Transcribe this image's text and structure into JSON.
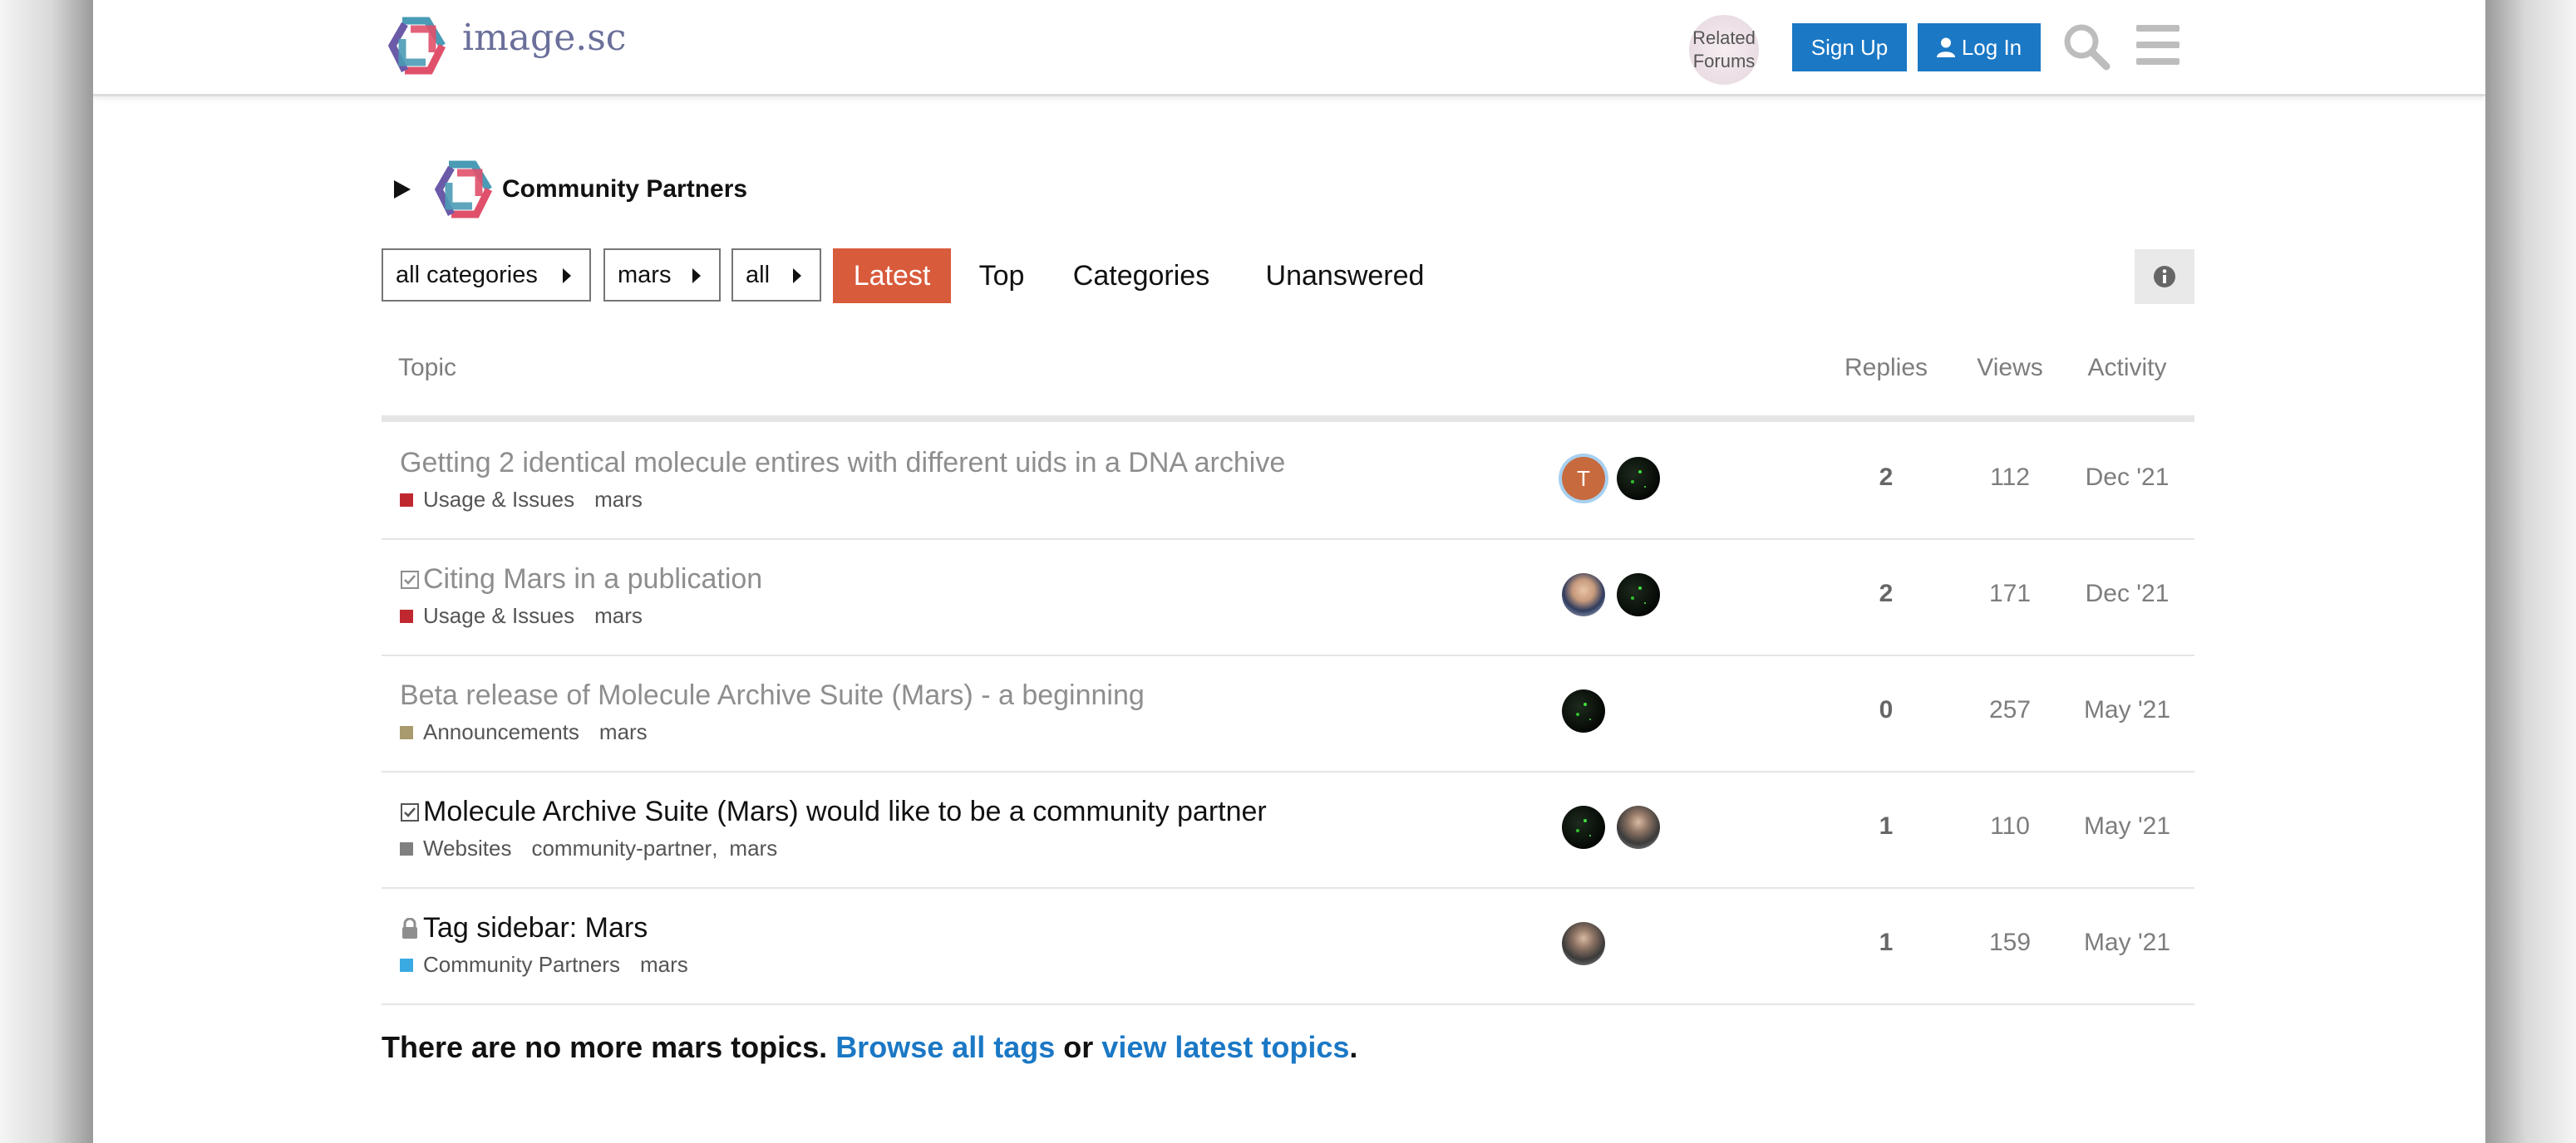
{
  "header": {
    "site_name": "image.sc",
    "related_line1": "Related",
    "related_line2": "Forums",
    "signup_label": "Sign Up",
    "login_label": "Log In",
    "icons": [
      "logo",
      "user-icon",
      "search-icon",
      "hamburger-menu-icon"
    ]
  },
  "category": {
    "title": "Community Partners"
  },
  "filters": {
    "categories": "all categories",
    "tag": "mars",
    "subset": "all"
  },
  "nav": {
    "items": [
      "Latest",
      "Top",
      "Categories",
      "Unanswered"
    ],
    "active": "Latest",
    "active_color": "#d85b3c"
  },
  "table": {
    "columns": [
      "Topic",
      "Replies",
      "Views",
      "Activity"
    ],
    "rows": [
      {
        "title": "Getting 2 identical molecule entires with different uids in a DNA archive",
        "status": "",
        "read": true,
        "category": "Usage & Issues",
        "category_color": "#c0282f",
        "tags": [
          "mars"
        ],
        "avatar_letter": "T",
        "replies": "2",
        "views": "112",
        "activity": "Dec '21"
      },
      {
        "title": "Citing Mars in a publication",
        "status": "solved",
        "read": true,
        "category": "Usage & Issues",
        "category_color": "#c0282f",
        "tags": [
          "mars"
        ],
        "replies": "2",
        "views": "171",
        "activity": "Dec '21"
      },
      {
        "title": "Beta release of Molecule Archive Suite (Mars) - a beginning",
        "status": "",
        "read": true,
        "category": "Announcements",
        "category_color": "#a89a6c",
        "tags": [
          "mars"
        ],
        "replies": "0",
        "views": "257",
        "activity": "May '21"
      },
      {
        "title": "Molecule Archive Suite (Mars) would like to be a community partner",
        "status": "solved",
        "read": false,
        "category": "Websites",
        "category_color": "#808080",
        "tags": [
          "community-partner",
          "mars"
        ],
        "replies": "1",
        "views": "110",
        "activity": "May '21"
      },
      {
        "title": "Tag sidebar: Mars",
        "status": "locked",
        "read": false,
        "category": "Community Partners",
        "category_color": "#3ba9e2",
        "tags": [
          "mars"
        ],
        "replies": "1",
        "views": "159",
        "activity": "May '21"
      }
    ]
  },
  "footer": {
    "prefix": "There are no more mars topics. ",
    "link1": "Browse all tags",
    "middle": " or ",
    "link2": "view latest topics",
    "suffix": "."
  }
}
